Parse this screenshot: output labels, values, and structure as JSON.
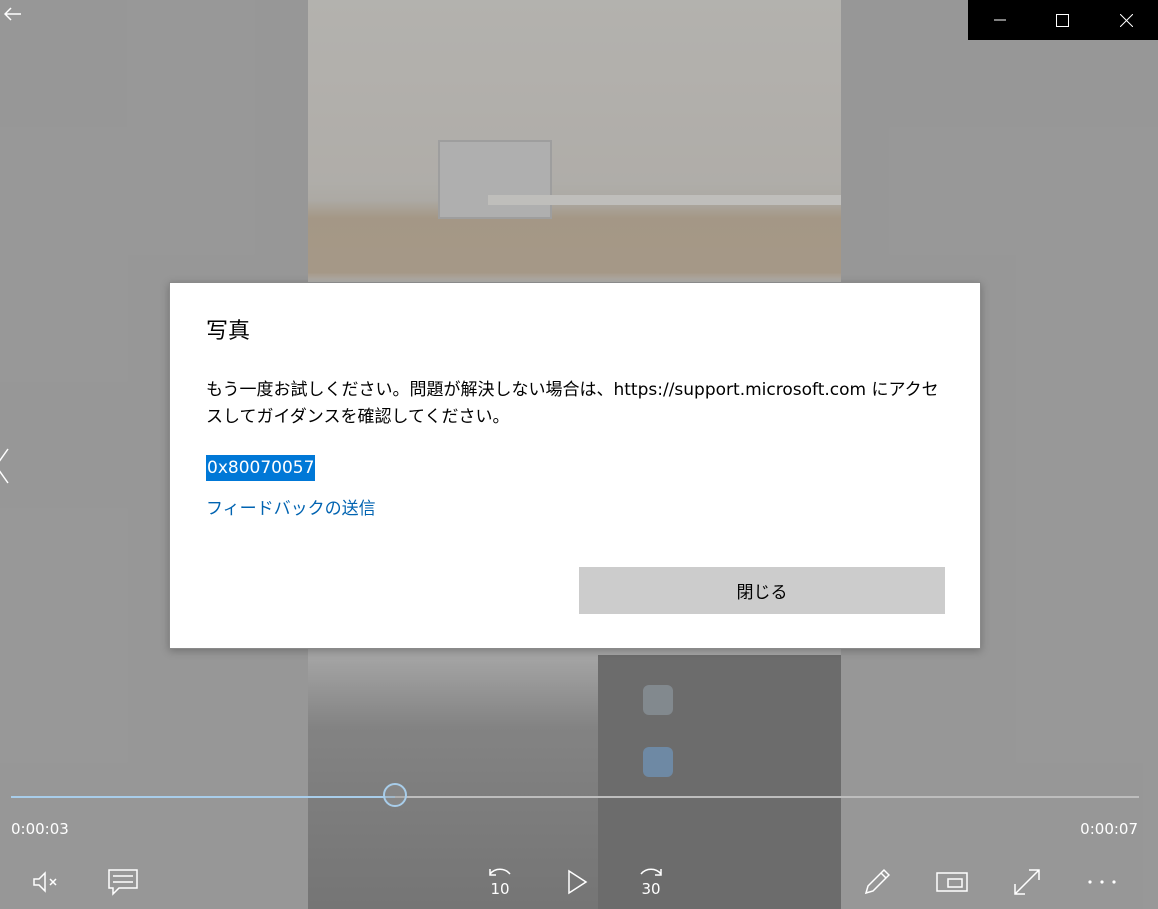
{
  "dialog": {
    "title": "写真",
    "message": "もう一度お試しください。問題が解決しない場合は、https://support.microsoft.com にアクセスしてガイダンスを確認してください。",
    "error_code": "0x80070057",
    "feedback_link": "フィードバックの送信",
    "close_label": "閉じる"
  },
  "player": {
    "current_time": "0:00:03",
    "total_time": "0:00:07",
    "progress_fraction": 0.34,
    "skip_back_seconds": "10",
    "skip_forward_seconds": "30"
  },
  "icons": {
    "back": "arrow-left-icon",
    "minimize": "minimize-icon",
    "maximize": "maximize-icon",
    "close": "close-icon",
    "prev": "chevron-left-icon",
    "mute": "volume-muted-icon",
    "captions": "captions-icon",
    "skip_back": "skip-back-icon",
    "play": "play-icon",
    "skip_forward": "skip-forward-icon",
    "edit": "pencil-icon",
    "miniview": "miniview-icon",
    "fullscreen": "fullscreen-icon",
    "more": "more-icon"
  },
  "colors": {
    "accent": "#0078d7",
    "link": "#0063b1",
    "seek_fill": "#a8cdea"
  }
}
